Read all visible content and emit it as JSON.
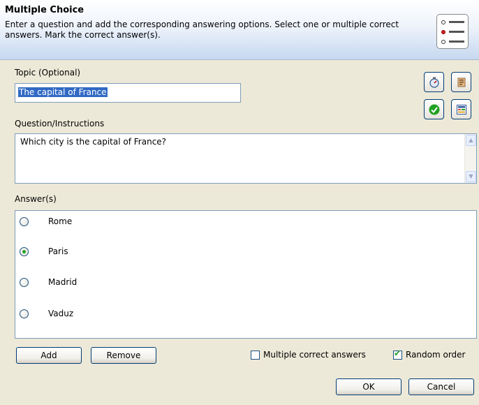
{
  "header": {
    "title": "Multiple Choice",
    "description": "Enter a question and add the corresponding answering options. Select one or multiple correct answers. Mark the correct answer(s).",
    "icon": "list-radio-icon"
  },
  "topic": {
    "label": "Topic (Optional)",
    "value": "The capital of France"
  },
  "tools": [
    {
      "name": "timer-icon"
    },
    {
      "name": "page-icon"
    },
    {
      "name": "check-icon"
    },
    {
      "name": "layout-icon"
    }
  ],
  "question": {
    "label": "Question/Instructions",
    "value": "Which city is the capital of France?"
  },
  "answers": {
    "label": "Answer(s)",
    "items": [
      {
        "text": "Rome",
        "selected": false
      },
      {
        "text": "Paris",
        "selected": true
      },
      {
        "text": "Madrid",
        "selected": false
      },
      {
        "text": "Vaduz",
        "selected": false
      }
    ]
  },
  "footer": {
    "add_label": "Add",
    "remove_label": "Remove",
    "multiple_label": "Multiple correct answers",
    "multiple_checked": false,
    "random_label": "Random order",
    "random_checked": true,
    "ok_label": "OK",
    "cancel_label": "Cancel"
  },
  "colors": {
    "accent_green": "#21a121",
    "selection_blue": "#316ac5"
  }
}
